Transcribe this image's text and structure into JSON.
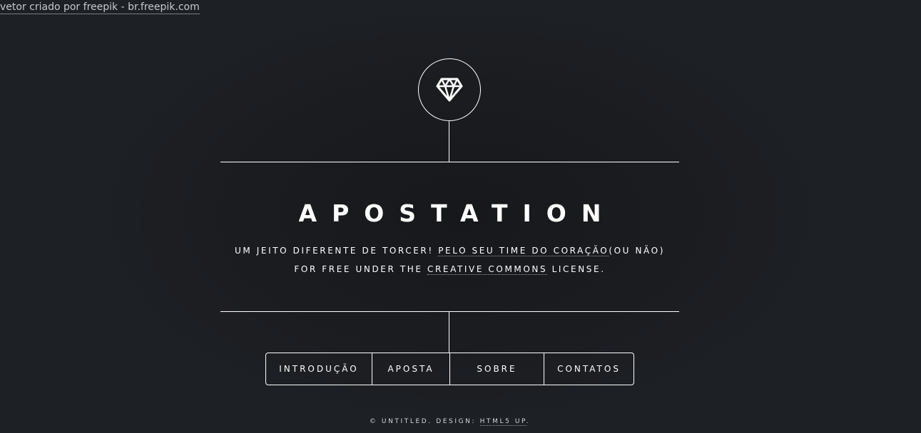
{
  "credit": {
    "text": "vetor criado por freepik - br.freepik.com"
  },
  "logo": {
    "icon": "diamond-icon"
  },
  "header": {
    "title": "APOSTATION",
    "tagline_line1_prefix": "UM JEITO DIFERENTE DE TORCER! ",
    "tagline_line1_link": "PELO SEU TIME DO CORAÇÃO",
    "tagline_line1_suffix": "(OU NÃO)",
    "tagline_line2_prefix": "FOR FREE UNDER THE ",
    "tagline_line2_link": "CREATIVE COMMONS",
    "tagline_line2_suffix": " LICENSE."
  },
  "nav": {
    "items": [
      {
        "label": "INTRODUÇÃO"
      },
      {
        "label": "APOSTA"
      },
      {
        "label": "SOBRE"
      },
      {
        "label": "CONTATOS"
      }
    ]
  },
  "footer": {
    "prefix": "© UNTITLED. DESIGN: ",
    "link": "HTML5 UP",
    "suffix": "."
  },
  "colors": {
    "background": "#1b1d21",
    "foreground": "#ffffff"
  }
}
